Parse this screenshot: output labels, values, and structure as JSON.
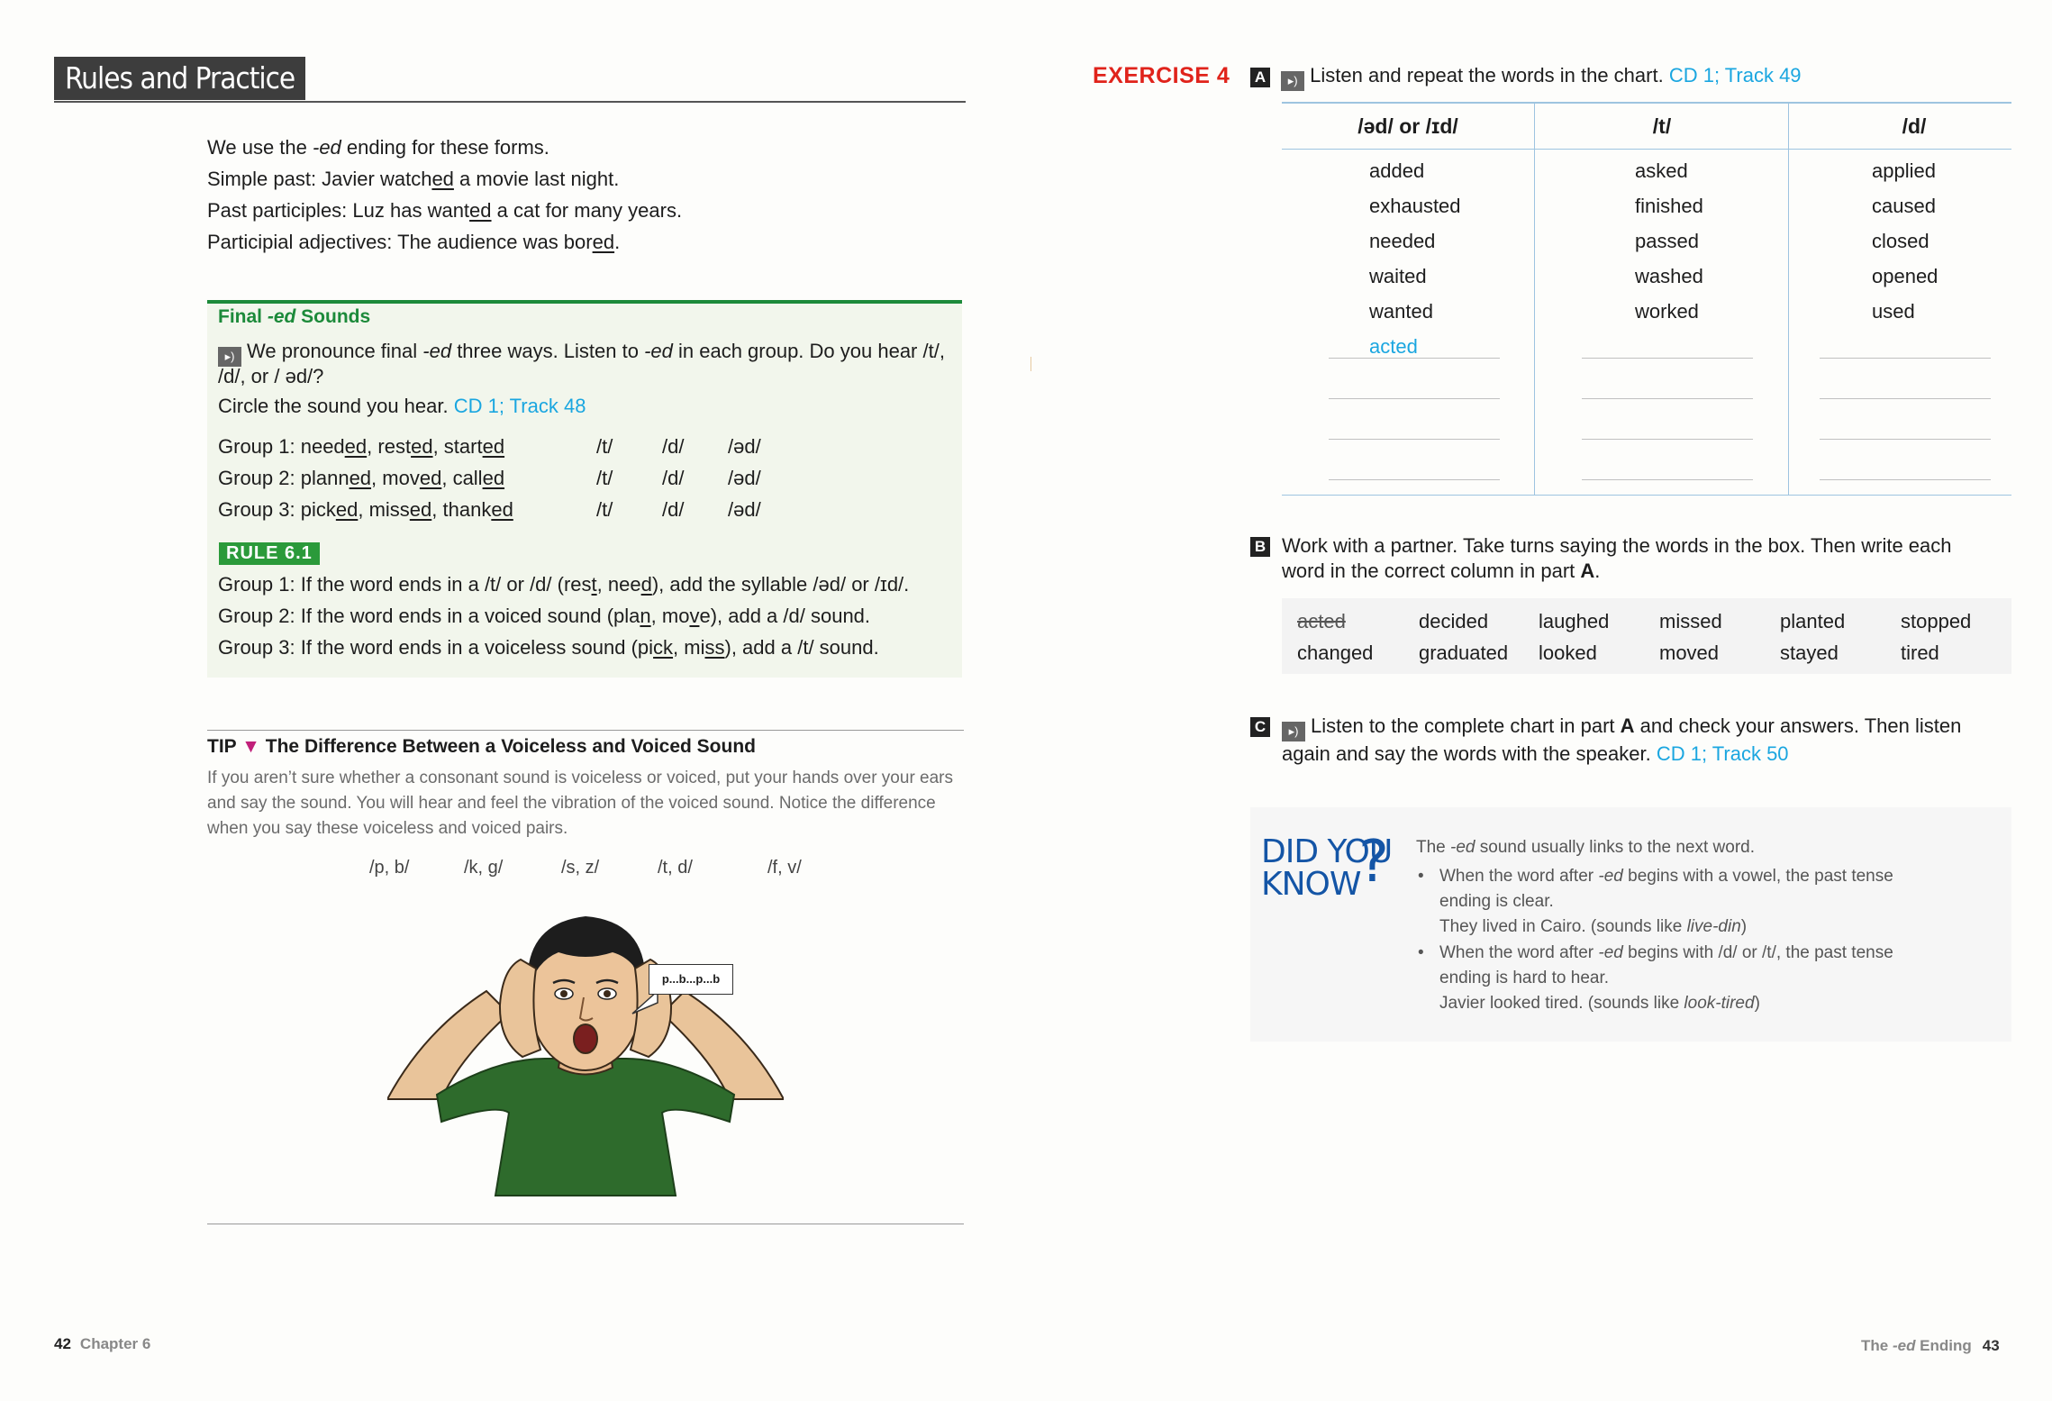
{
  "left_page": {
    "section_title": "Rules and Practice",
    "intro": [
      {
        "pre": "We use the ",
        "em": "-ed",
        "post": " ending for these forms."
      },
      {
        "pre": "Simple past: Javier watch",
        "u": "ed",
        "post": " a movie last night."
      },
      {
        "pre": "Past participles: Luz has want",
        "u": "ed",
        "post": " a cat for many years."
      },
      {
        "pre": "Participial adjectives: The audience was bor",
        "u": "ed",
        "post": "."
      }
    ],
    "final_sounds": {
      "heading_pre": "Final ",
      "heading_em": "-ed",
      "heading_post": " Sounds",
      "line1_pre": "We pronounce final ",
      "line1_em": "-ed",
      "line1_mid": " three ways. Listen to ",
      "line1_em2": "-ed",
      "line1_post": " in each group. Do you hear /t/,",
      "line2": "/d/, or / əd/?",
      "line3": "Circle the sound you hear.",
      "cd_track": "CD 1; Track 48",
      "groups": [
        {
          "label": "Group 1: ",
          "words": [
            [
              "need",
              "ed"
            ],
            [
              "rest",
              "ed"
            ],
            [
              "start",
              "ed"
            ]
          ],
          "sounds": [
            "/t/",
            "/d/",
            "/əd/"
          ]
        },
        {
          "label": "Group 2: ",
          "words": [
            [
              "plann",
              "ed"
            ],
            [
              "mov",
              "ed"
            ],
            [
              "call",
              "ed"
            ]
          ],
          "sounds": [
            "/t/",
            "/d/",
            "/əd/"
          ]
        },
        {
          "label": "Group 3: ",
          "words": [
            [
              "pick",
              "ed"
            ],
            [
              "miss",
              "ed"
            ],
            [
              "thank",
              "ed"
            ]
          ],
          "sounds": [
            "/t/",
            "/d/",
            "/əd/"
          ]
        }
      ],
      "rule_badge": "RULE 6.1",
      "rules": [
        {
          "text1": "Group 1: If the word ends in a /t/ or /d/ (res",
          "u1": "t",
          "text2": ", nee",
          "u2": "d",
          "text3": "), add the syllable /əd/ or /ɪd/."
        },
        {
          "text1": "Group 2: If the word ends in a voiced sound (pla",
          "u1": "n",
          "text2": ", mo",
          "u2": "v",
          "text3": "e), add a /d/ sound."
        },
        {
          "text1": "Group 3: If the word ends in a voiceless sound (pi",
          "u1": "ck",
          "text2": ", mi",
          "u2": "ss",
          "text3": "), add a /t/ sound."
        }
      ]
    },
    "tip": {
      "label": "TIP",
      "arrow": "▼",
      "heading": "The Difference Between a Voiceless and Voiced Sound",
      "body": "If you aren’t sure whether a consonant sound is voiceless or voiced, put your hands over your ears and say the sound. You will hear and feel the vibration of the voiced sound. Notice the difference when you say these voiceless and voiced pairs.",
      "pairs": [
        "/p, b/",
        "/k, g/",
        "/s, z/",
        "/t, d/",
        "/f, v/"
      ],
      "speech_bubble": "p...b...p...b"
    },
    "folio_number": "42",
    "folio_label": "Chapter 6"
  },
  "right_page": {
    "exercise_label": "EXERCISE 4",
    "part_a": {
      "letter": "A",
      "instruction": "Listen and repeat the words in the chart.",
      "cd_track": "CD 1; Track 49",
      "columns": [
        {
          "header": "/əd/ or /ɪd/",
          "words": [
            "added",
            "exhausted",
            "needed",
            "waited",
            "wanted"
          ],
          "filled": "acted"
        },
        {
          "header": "/t/",
          "words": [
            "asked",
            "finished",
            "passed",
            "washed",
            "worked"
          ],
          "filled": ""
        },
        {
          "header": "/d/",
          "words": [
            "applied",
            "caused",
            "closed",
            "opened",
            "used"
          ],
          "filled": ""
        }
      ]
    },
    "part_b": {
      "letter": "B",
      "instruction_1": "Work with a partner. Take turns saying the words in the box. Then write each",
      "instruction_2_pre": "word in the correct column in part ",
      "instruction_2_bold": "A",
      "instruction_2_post": ".",
      "word_box": [
        [
          "acted",
          "decided",
          "laughed",
          "missed",
          "planted",
          "stopped"
        ],
        [
          "changed",
          "graduated",
          "looked",
          "moved",
          "stayed",
          "tired"
        ]
      ]
    },
    "part_c": {
      "letter": "C",
      "instruction_1_pre": "Listen to the complete chart in part ",
      "instruction_1_bold": "A",
      "instruction_1_post": " and check your answers. Then listen",
      "instruction_2": "again and say the words with the speaker.",
      "cd_track": "CD 1; Track 50"
    },
    "did_you_know": {
      "title_1": "DID YOU",
      "title_2": "KNOW",
      "question_mark": "?",
      "intro_pre": "The ",
      "intro_em": "-ed",
      "intro_post": " sound usually links to the next word.",
      "bullet1_line1_pre": "When the word after ",
      "bullet1_line1_em": "-ed",
      "bullet1_line1_post": " begins with a vowel, the past tense",
      "bullet1_line2": "ending is clear.",
      "example1_pre": "They lived in Cairo. (sounds like ",
      "example1_em": "live-din",
      "example1_post": ")",
      "bullet2_line1_pre": "When the word after ",
      "bullet2_line1_em": "-ed",
      "bullet2_line1_post": " begins with /d/ or /t/, the past tense",
      "bullet2_line2": "ending is hard to hear.",
      "example2_pre": "Javier looked tired. (sounds like ",
      "example2_em": "look-tired",
      "example2_post": ")"
    },
    "folio_pre": "The ",
    "folio_em": "-ed",
    "folio_post": " Ending",
    "folio_number": "43"
  }
}
